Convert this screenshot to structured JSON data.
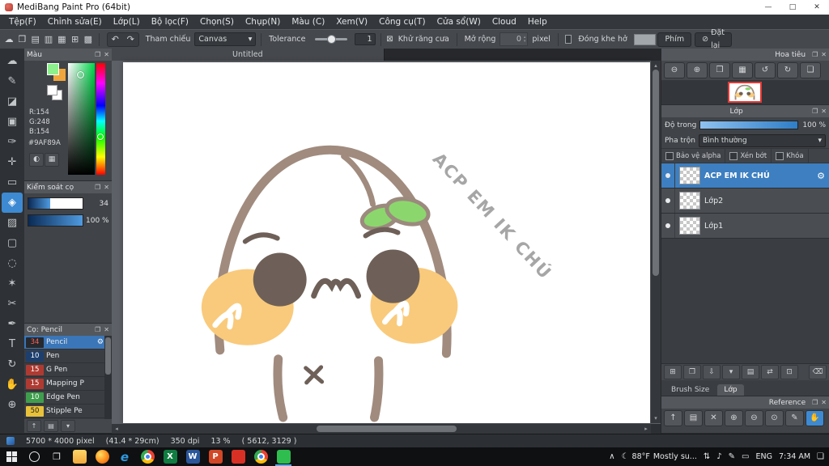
{
  "window": {
    "title": "MediBang Paint Pro (64bit)",
    "minimize": "—",
    "maximize": "□",
    "close": "✕"
  },
  "menu": {
    "items": [
      "Tệp(F)",
      "Chỉnh sửa(E)",
      "Lớp(L)",
      "Bộ lọc(F)",
      "Chọn(S)",
      "Chụp(N)",
      "Màu (C)",
      "Xem(V)",
      "Công cụ(T)",
      "Cửa sổ(W)",
      "Cloud",
      "Help"
    ]
  },
  "toolbar": {
    "icons": [
      {
        "name": "cloud",
        "glyph": "☁"
      },
      {
        "name": "publish",
        "glyph": "❐"
      },
      {
        "name": "open",
        "glyph": "▤"
      },
      {
        "name": "save",
        "glyph": "▥"
      },
      {
        "name": "export",
        "glyph": "▦"
      },
      {
        "name": "grid",
        "glyph": "⊞"
      },
      {
        "name": "material",
        "glyph": "▩"
      }
    ],
    "reference_label": "Tham chiếu",
    "reference_value": "Canvas",
    "tolerance_label": "Tolerance",
    "tolerance_value": "1",
    "antialias_label": "Khử răng cưa",
    "expand_label": "Mở rộng",
    "expand_value": "0",
    "expand_unit": "pixel",
    "close_gap_label": "Đóng khe hở",
    "key_button": "Phím",
    "reset_button": "Đặt lại"
  },
  "tools": {
    "items": [
      {
        "name": "cloud",
        "glyph": "☁",
        "selected": false
      },
      {
        "name": "pen",
        "glyph": "✎",
        "selected": false
      },
      {
        "name": "eraser",
        "glyph": "◪",
        "selected": false
      },
      {
        "name": "stamp",
        "glyph": "▣",
        "selected": false
      },
      {
        "name": "brush",
        "glyph": "✑",
        "selected": false
      },
      {
        "name": "move",
        "glyph": "✛",
        "selected": false
      },
      {
        "name": "marquee",
        "glyph": "▭",
        "selected": false
      },
      {
        "name": "bucket",
        "glyph": "◈",
        "selected": true
      },
      {
        "name": "gradient",
        "glyph": "▨",
        "selected": false
      },
      {
        "name": "select",
        "glyph": "▢",
        "selected": false
      },
      {
        "name": "lasso",
        "glyph": "◌",
        "selected": false
      },
      {
        "name": "magic-wand",
        "glyph": "✶",
        "selected": false
      },
      {
        "name": "divide",
        "glyph": "✂",
        "selected": false
      },
      {
        "name": "pen-nib",
        "glyph": "✒",
        "selected": false
      },
      {
        "name": "text",
        "glyph": "T",
        "selected": false
      },
      {
        "name": "rotate",
        "glyph": "↻",
        "selected": false
      },
      {
        "name": "hand",
        "glyph": "✋",
        "selected": false
      },
      {
        "name": "zoom",
        "glyph": "⊕",
        "selected": false
      }
    ]
  },
  "color_panel": {
    "title": "Màu",
    "r": "R:154",
    "g": "G:248",
    "b": "B:154",
    "hex": "#9AF89A",
    "foreground_color": "#8df08d",
    "secondary_color": "#f0a63c"
  },
  "brush_control": {
    "title": "Kiểm soát cọ",
    "size_value": "34",
    "opacity_value": "100 %"
  },
  "brush_panel": {
    "title": "Cọ: Pencil",
    "brushes": [
      {
        "size": "34",
        "name": "Pencil",
        "selected": true
      },
      {
        "size": "10",
        "name": "Pen",
        "selected": false
      },
      {
        "size": "15",
        "name": "G Pen",
        "selected": false
      },
      {
        "size": "15",
        "name": "Mapping P",
        "selected": false
      },
      {
        "size": "10",
        "name": "Edge Pen",
        "selected": false
      },
      {
        "size": "50",
        "name": "Stipple Pe",
        "selected": false
      }
    ]
  },
  "canvas": {
    "tab": "Untitled",
    "sticker_text": "ACP EM IK CHÚ"
  },
  "navigator": {
    "title": "Hoa tiêu"
  },
  "layers": {
    "title": "Lớp",
    "opacity_label": "Độ trong",
    "opacity_value": "100 %",
    "blend_label": "Pha trộn",
    "blend_value": "Bình thường",
    "protect_alpha": "Bảo vệ alpha",
    "clipping": "Xén bớt",
    "lock": "Khóa",
    "items": [
      {
        "name": "ACP EM IK CHÚ",
        "selected": true
      },
      {
        "name": "Lớp2",
        "selected": false
      },
      {
        "name": "Lớp1",
        "selected": false
      }
    ],
    "tabs": {
      "brush_size": "Brush Size",
      "layer": "Lớp"
    }
  },
  "reference": {
    "title": "Reference"
  },
  "status": {
    "size": "5700 * 4000 pixel",
    "dimensions": "(41.4 * 29cm)",
    "dpi": "350 dpi",
    "zoom": "13 %",
    "coords": "( 5612, 3129 )"
  },
  "taskbar": {
    "weather_temp": "88°F",
    "weather_desc": "Mostly su...",
    "language": "ENG",
    "time": "7:34 AM"
  },
  "colors": {
    "accent_blue": "#3d8ad2",
    "selected_layer": "#3d7fc1",
    "canvas_outline": "#a08b7e",
    "face_features": "#6e6058",
    "cheek": "#f9ca7b",
    "leaf": "#8bd76d"
  },
  "glyphs": {
    "popout": "❐",
    "close": "✕",
    "gear": "⚙",
    "caret": "▾",
    "spin_up": "▴",
    "spin_down": "▾",
    "undo": "↶",
    "redo": "↷",
    "antialias": "⊠",
    "reset": "⊘",
    "nav_zoom_out": "⊖",
    "nav_zoom_in": "⊕",
    "nav_fit": "❒",
    "nav_grid": "▦",
    "nav_rot_left": "↺",
    "nav_rot_right": "↻",
    "nav_reset": "❑",
    "layer_add": "⊞",
    "layer_dup": "❐",
    "layer_merge": "⇩",
    "layer_folder": "▤",
    "layer_transfer": "⇄",
    "layer_combine": "⊡",
    "layer_trash": "⌫",
    "ref_up": "↑",
    "ref_folder": "▤",
    "ref_close": "✕",
    "ref_zoom_in": "⊕",
    "ref_zoom_out": "⊖",
    "ref_zoom_reset": "⊙",
    "ref_pick": "✎",
    "ref_hand": "✋",
    "scroll_up": "▴",
    "scroll_down": "▾",
    "scroll_left": "◂",
    "scroll_right": "▸",
    "color_wheel": "◐",
    "color_grid": "▦",
    "brush_add": "↑",
    "brush_folder": "▤",
    "search": "",
    "task_view": "❐",
    "app_edge": "e",
    "app_excel": "X",
    "app_word": "W",
    "app_ppt": "P",
    "tray_chevron": "∧",
    "moon": "☾",
    "tray_net": "⇅",
    "tray_sound": "♪",
    "tray_pen": "✎",
    "tray_kbd": "▭",
    "tray_notif": "❏"
  }
}
